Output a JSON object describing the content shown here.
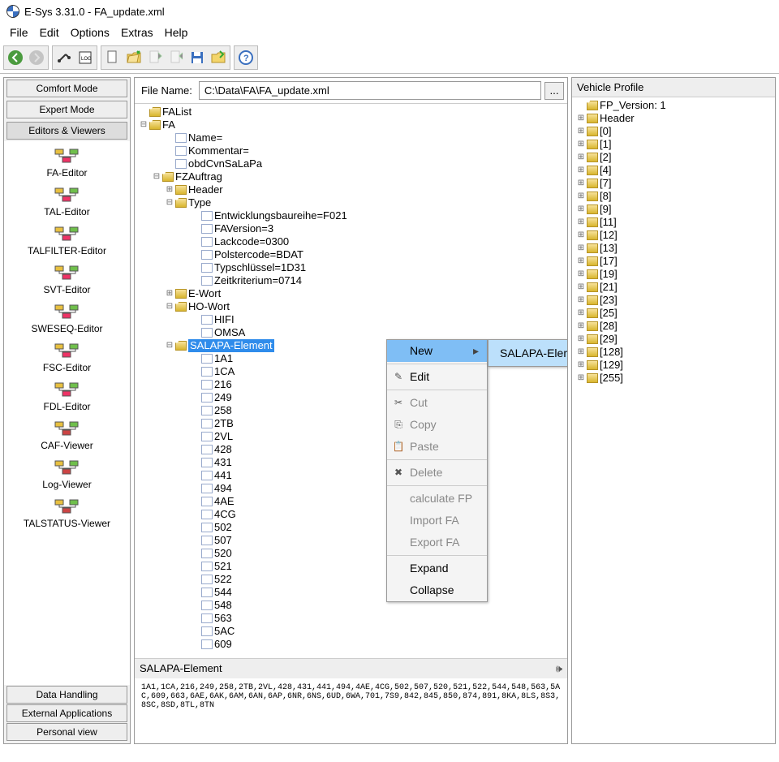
{
  "window_title": "E-Sys 3.31.0 - FA_update.xml",
  "menu": [
    "File",
    "Edit",
    "Options",
    "Extras",
    "Help"
  ],
  "sidebar": {
    "top_buttons": [
      "Comfort Mode",
      "Expert Mode",
      "Editors & Viewers"
    ],
    "items": [
      {
        "label": "FA-Editor"
      },
      {
        "label": "TAL-Editor"
      },
      {
        "label": "TALFILTER-Editor"
      },
      {
        "label": "SVT-Editor"
      },
      {
        "label": "SWESEQ-Editor"
      },
      {
        "label": "FSC-Editor"
      },
      {
        "label": "FDL-Editor"
      },
      {
        "label": "CAF-Viewer"
      },
      {
        "label": "Log-Viewer"
      },
      {
        "label": "TALSTATUS-Viewer"
      }
    ],
    "bottom_buttons": [
      "Data Handling",
      "External Applications",
      "Personal view"
    ]
  },
  "file": {
    "label": "File Name:",
    "value": "C:\\Data\\FA\\FA_update.xml",
    "browse": "..."
  },
  "tree": {
    "root": "FAList",
    "fa": "FA",
    "fa_children": [
      "Name=",
      "Kommentar=",
      "obdCvnSaLaPa"
    ],
    "fzauftrag": "FZAuftrag",
    "header": "Header",
    "type": "Type",
    "type_children": [
      "Entwicklungsbaureihe=F021",
      "FAVersion=3",
      "Lackcode=0300",
      "Polstercode=BDAT",
      "Typschlüssel=1D31",
      "Zeitkriterium=0714"
    ],
    "ewort": "E-Wort",
    "howort": "HO-Wort",
    "howort_children": [
      "HIFI",
      "OMSA"
    ],
    "salapa": "SALAPA-Element",
    "salapa_children": [
      "1A1",
      "1CA",
      "216",
      "249",
      "258",
      "2TB",
      "2VL",
      "428",
      "431",
      "441",
      "494",
      "4AE",
      "4CG",
      "502",
      "507",
      "520",
      "521",
      "522",
      "544",
      "548",
      "563",
      "5AC",
      "609"
    ]
  },
  "context_menu": {
    "new": "New",
    "edit": "Edit",
    "cut": "Cut",
    "copy": "Copy",
    "paste": "Paste",
    "delete": "Delete",
    "calc": "calculate FP",
    "import": "Import FA",
    "export": "Export FA",
    "expand": "Expand",
    "collapse": "Collapse",
    "sub": "SALAPA-Element"
  },
  "bottom_panel": {
    "title": "SALAPA-Element",
    "body": "1A1,1CA,216,249,258,2TB,2VL,428,431,441,494,4AE,4CG,502,507,520,521,522,544,548,563,5AC,609,663,6AE,6AK,6AM,6AN,6AP,6NR,6NS,6UD,6WA,701,7S9,842,845,850,874,891,8KA,8LS,8S3,8SC,8SD,8TL,8TN"
  },
  "right": {
    "title": "Vehicle Profile",
    "root": "FP_Version: 1",
    "header": "Header",
    "items": [
      "[0]",
      "[1]",
      "[2]",
      "[4]",
      "[7]",
      "[8]",
      "[9]",
      "[11]",
      "[12]",
      "[13]",
      "[17]",
      "[19]",
      "[21]",
      "[23]",
      "[25]",
      "[28]",
      "[29]",
      "[128]",
      "[129]",
      "[255]"
    ]
  }
}
